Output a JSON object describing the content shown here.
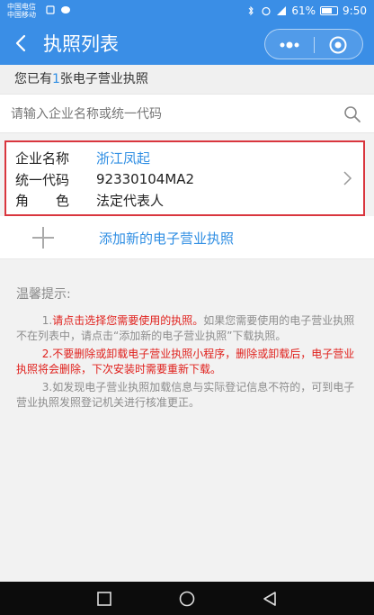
{
  "status_bar": {
    "carrier_line1": "中国电信",
    "carrier_line2": "中国移动",
    "battery": "61%",
    "time": "9:50"
  },
  "header": {
    "title": "执照列表",
    "back_icon": "back-arrow-icon",
    "more_icon": "more-dots-icon",
    "close_icon": "target-circle-icon"
  },
  "summary": {
    "prefix": "您已有",
    "count": "1",
    "suffix": "张电子营业执照"
  },
  "search": {
    "placeholder": "请输入企业名称或统一代码"
  },
  "license_card": {
    "name_label": "企业名称",
    "name_value": "浙江凤起",
    "code_label": "统一代码",
    "code_value": "92330104MA2",
    "role_label": "角　　色",
    "role_value": "法定代表人"
  },
  "add_license": {
    "label": "添加新的电子营业执照"
  },
  "tips": {
    "title": "温馨提示:",
    "tip1_number": "1.",
    "tip1_red": "请点击选择您需要使用的执照。",
    "tip1_rest": "如果您需要使用的电子营业执照不在列表中，请点击“添加新的电子营业执照”下载执照。",
    "tip2": "2.不要删除或卸载电子营业执照小程序，删除或卸载后，电子营业执照将会删除，下次安装时需要重新下载。",
    "tip3": "3.如发现电子营业执照加载信息与实际登记信息不符的，可到电子营业执照发照登记机关进行核准更正。"
  },
  "colors": {
    "primary": "#3a8ee6",
    "link": "#2f8ee3",
    "warning": "#e0201c",
    "card_border": "#d9363e"
  }
}
